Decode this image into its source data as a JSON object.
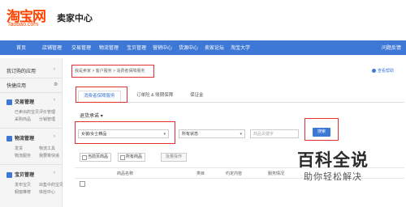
{
  "header": {
    "logo_main": "淘宝网",
    "logo_domain": "Taobao.com",
    "seller_center": "卖家中心"
  },
  "nav": {
    "items": [
      "首页",
      "店铺管理",
      "交易管理",
      "物流管理",
      "宝贝管理",
      "营销中心",
      "货源中心",
      "卖家论坛",
      "淘宝大学"
    ],
    "right": "问题反馈"
  },
  "sidebar": {
    "recent": "我订购的应用",
    "quick": "快捷应用",
    "quick_action": "设置",
    "sections": [
      {
        "title": "交易管理",
        "items": [
          "已卖出的宝贝",
          "评价管理",
          "采购商品",
          "分销管理"
        ]
      },
      {
        "title": "物流管理",
        "items": [
          "发货",
          "物流工具",
          "物流服务",
          "我要寄快递"
        ]
      },
      {
        "title": "宝贝管理",
        "items": [
          "发布宝贝",
          "出售中的宝贝",
          "橱窗推荐",
          "体检中心"
        ]
      }
    ]
  },
  "breadcrumb": {
    "text": "我是卖家 > 客户服务 > 消费者保障服务"
  },
  "help": {
    "label": "查看帮助"
  },
  "tabs": [
    {
      "label": "消费者保障服务",
      "active": true
    },
    {
      "label": "订单险 & 账期保障",
      "active": false
    },
    {
      "label": "保证金",
      "active": false
    }
  ],
  "filter": {
    "section_label": "退货承诺",
    "category_value": "女装/女士精品",
    "status_value": "所有状态",
    "keyword_placeholder": "商品关键字",
    "search_label": "搜索"
  },
  "actions": {
    "current_page": "当前页商品",
    "all_items": "所有商品",
    "batch": "批量操作"
  },
  "table": {
    "headers": [
      "商品名称",
      "类目",
      "约定内容",
      "服务情况"
    ]
  },
  "watermark": {
    "title": "百科全说",
    "subtitle": "助你轻松解决"
  }
}
